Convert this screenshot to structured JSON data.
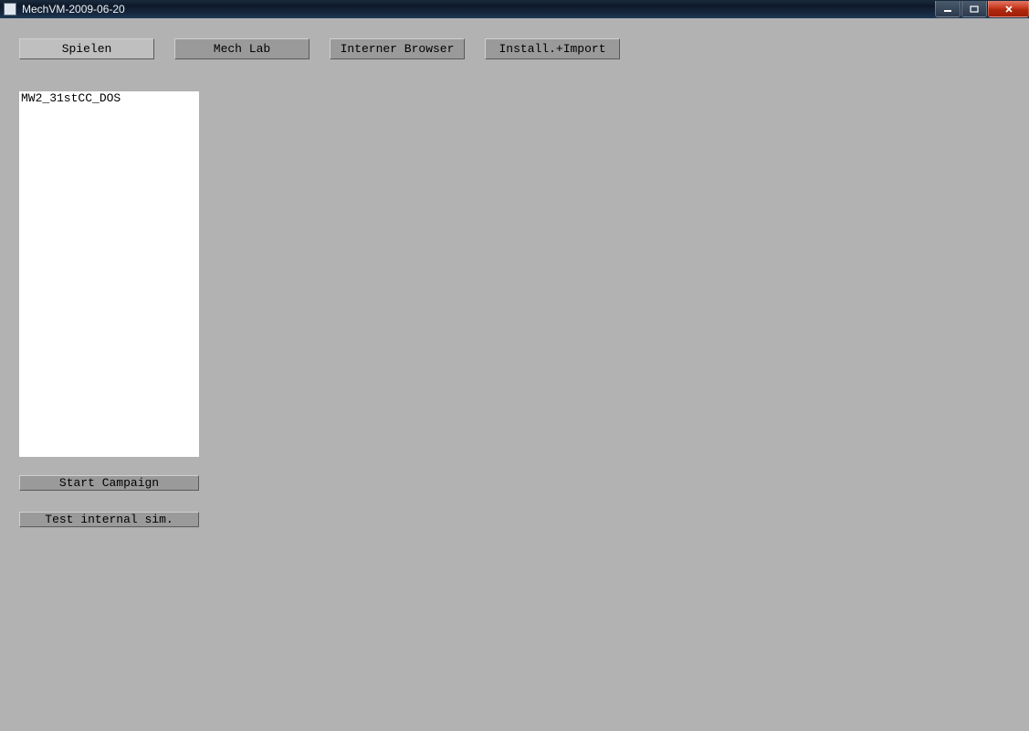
{
  "window": {
    "title": "MechVM-2009-06-20"
  },
  "tabs": {
    "spielen": "Spielen",
    "mechlab": "Mech Lab",
    "browser": "Interner Browser",
    "install": "Install.+Import"
  },
  "list": {
    "items": [
      "MW2_31stCC_DOS"
    ]
  },
  "buttons": {
    "start_campaign": "Start Campaign",
    "test_sim": "Test internal sim."
  }
}
